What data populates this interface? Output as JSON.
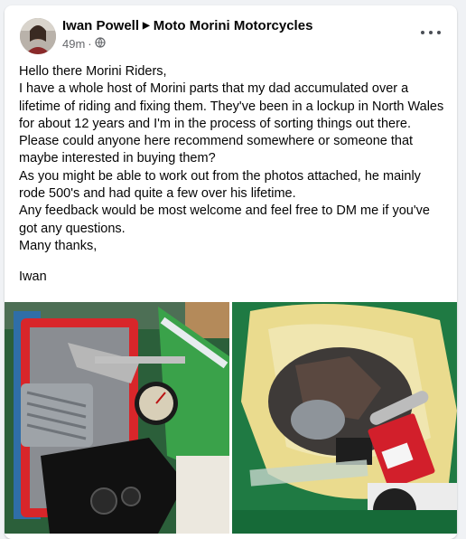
{
  "post": {
    "author": "Iwan Powell",
    "group": "Moto Morini Motorcycles",
    "time": "49m",
    "privacy_icon": "globe-icon",
    "more_icon": "more-options-icon",
    "body_lines": [
      "Hello there Morini Riders,",
      "I have a whole host of Morini parts that my dad accumulated over a lifetime of riding and fixing them. They've been in a lockup in North Wales for about 12 years and I'm in the process of sorting things out there.",
      "Please could anyone here recommend somewhere or someone that maybe interested in buying them?",
      "As you might be able to work out from the photos attached, he mainly rode 500's and had quite a few over his lifetime.",
      "Any feedback would be most welcome and feel free to DM me if you've got any questions.",
      "Many thanks,"
    ],
    "signature": "Iwan"
  },
  "photos": [
    {
      "name": "photo-parts-box",
      "colors": {
        "bin": "#2a6b3a",
        "tray": "#d8262a",
        "bag": "#3aa24a"
      }
    },
    {
      "name": "photo-parts-bag",
      "colors": {
        "bin": "#1f7a43",
        "bag": "#e8d98a",
        "tag": "#d21f2b"
      }
    }
  ],
  "colors": {
    "background": "#f0f2f5",
    "card": "#ffffff",
    "secondary_text": "#65676b"
  }
}
